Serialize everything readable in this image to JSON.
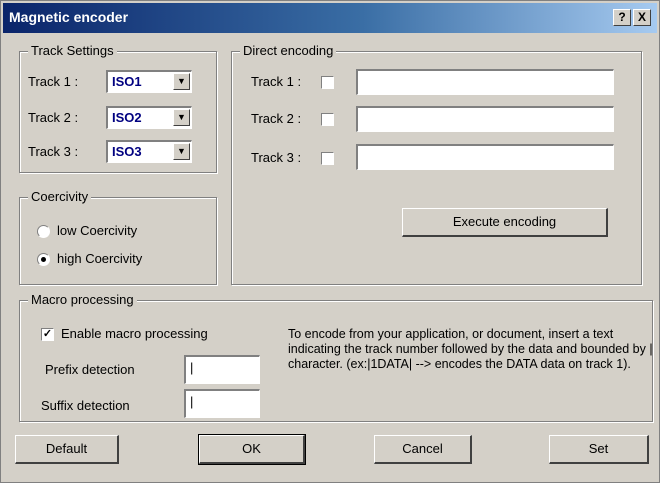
{
  "window": {
    "title": "Magnetic encoder",
    "help_label": "?",
    "close_label": "X"
  },
  "track_settings": {
    "legend": "Track Settings",
    "tracks": [
      {
        "label": "Track 1 :",
        "value": "ISO1"
      },
      {
        "label": "Track 2 :",
        "value": "ISO2"
      },
      {
        "label": "Track 3 :",
        "value": "ISO3"
      }
    ]
  },
  "direct_encoding": {
    "legend": "Direct encoding",
    "tracks": [
      {
        "label": "Track 1 :",
        "checked": false,
        "value": ""
      },
      {
        "label": "Track 2 :",
        "checked": false,
        "value": ""
      },
      {
        "label": "Track 3 :",
        "checked": false,
        "value": ""
      }
    ],
    "execute_label": "Execute encoding"
  },
  "coercivity": {
    "legend": "Coercivity",
    "options": [
      {
        "label": "low Coercivity",
        "selected": false
      },
      {
        "label": "high Coercivity",
        "selected": true
      }
    ]
  },
  "macro": {
    "legend": "Macro processing",
    "enable_label": "Enable macro processing",
    "enable_checked": true,
    "check_mark": "✓",
    "prefix_label": "Prefix detection",
    "prefix_value": "|",
    "suffix_label": "Suffix detection",
    "suffix_value": "|",
    "help_text": "To encode from your application, or document, insert a text indicating the track number followed by the data and bounded by | character. (ex:|1DATA| --> encodes the DATA data on track 1)."
  },
  "buttons": {
    "default": "Default",
    "ok": "OK",
    "cancel": "Cancel",
    "set": "Set"
  },
  "colors": {
    "titlebar_start": "#0a246a",
    "titlebar_end": "#a6caf0",
    "face": "#d4d0c8",
    "combo_text": "#000080"
  },
  "icons": {
    "combo_arrow": "▼"
  }
}
